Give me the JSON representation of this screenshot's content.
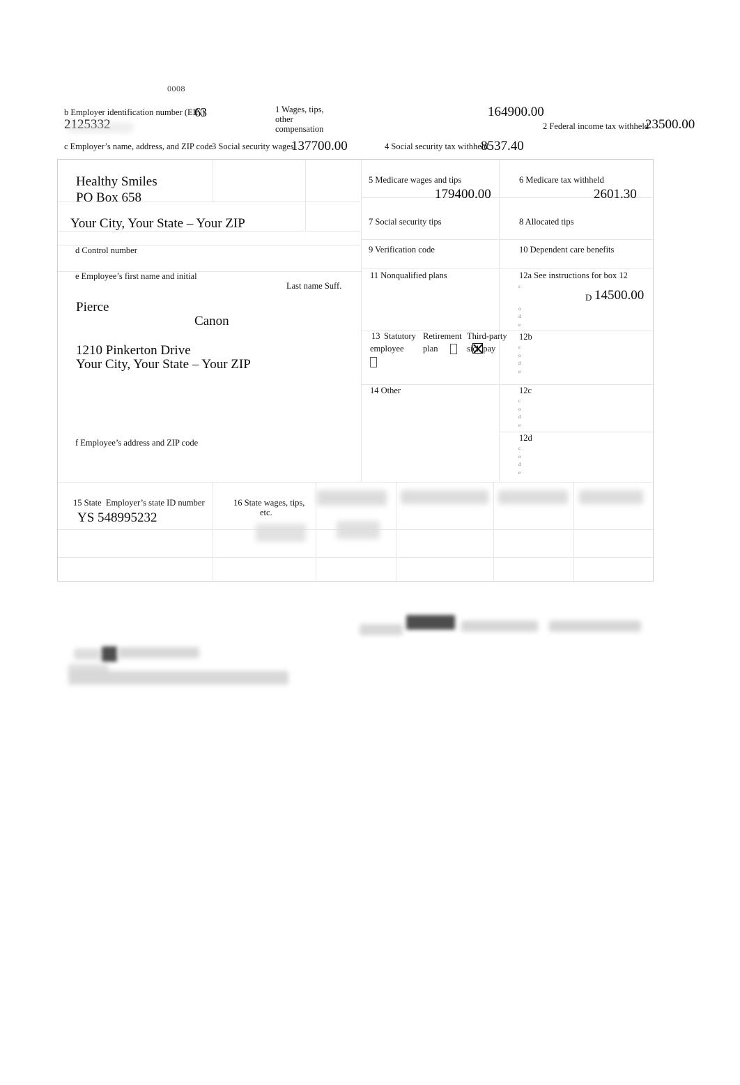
{
  "form": {
    "control_code": "0008",
    "copy_note": ""
  },
  "boxes": {
    "b": {
      "label": "b Employer identification number (EIN)",
      "overlap_text": "63",
      "value": "2125332"
    },
    "c": {
      "label": "c Employer’s name, address, and ZIP code",
      "name": "Healthy Smiles",
      "street": "PO Box 658",
      "citystatezip": "Your City, Your State – Your ZIP"
    },
    "d": {
      "label": "d Control number",
      "value": ""
    },
    "e": {
      "label": "e Employee’s first name and initial",
      "last_name_label": "Last name Suff.",
      "first_name": "Pierce",
      "last_name": "Canon"
    },
    "f": {
      "label": "f Employee’s address and ZIP code",
      "street": "1210 Pinkerton Drive",
      "citystatezip": "Your City, Your State – Your ZIP"
    },
    "b1": {
      "label": "1 Wages, tips, other compensation",
      "label_l1": "1 Wages, tips,",
      "label_l2": "other",
      "label_l3": "compensation",
      "value": "164900.00"
    },
    "b2": {
      "label": "2 Federal income tax withheld",
      "value": "23500.00"
    },
    "b3": {
      "label": "3 Social security wages",
      "value": "137700.00"
    },
    "b4": {
      "label": "4 Social security tax withheld",
      "value": "8537.40"
    },
    "b5": {
      "label": "5 Medicare wages and tips",
      "value": "179400.00"
    },
    "b6": {
      "label": "6 Medicare tax withheld",
      "value": "2601.30"
    },
    "b7": {
      "label": "7 Social security tips",
      "value": ""
    },
    "b8": {
      "label": "8 Allocated tips",
      "value": ""
    },
    "b9": {
      "label": "9 Verification code",
      "value": ""
    },
    "b10": {
      "label": "10 Dependent care benefits",
      "value": ""
    },
    "b11": {
      "label": "11 Nonqualified plans",
      "value": ""
    },
    "b12a": {
      "label": "12a See instructions for box 12",
      "code_stack": [
        "c",
        "o",
        "d",
        "e"
      ],
      "code": "D",
      "value": "14500.00"
    },
    "b12b": {
      "label": "12b",
      "code_stack": [
        "c",
        "o",
        "d",
        "e"
      ],
      "code": "",
      "value": ""
    },
    "b12c": {
      "label": "12c",
      "code_stack": [
        "c",
        "o",
        "d",
        "e"
      ],
      "code": "",
      "value": ""
    },
    "b12d": {
      "label": "12d",
      "code_stack": [
        "c",
        "o",
        "d",
        "e"
      ],
      "code": "",
      "value": ""
    },
    "b13": {
      "number": "13",
      "col1_l1": "Statutory",
      "col1_l2": "employee",
      "col2_l1": "Retirement",
      "col2_l2": "plan",
      "col3_l1": "Third-party",
      "col3_l2": "sick pay",
      "statutory_checked": false,
      "retirement_checked": true,
      "thirdparty_checked": false
    },
    "b14": {
      "label": "14 Other",
      "value": ""
    },
    "b15": {
      "label_l1": "15 State",
      "label_l2": "Employer’s state ID number",
      "label": "15 State  Employer’s state ID number",
      "state": "YS",
      "id_number": "548995232",
      "value": "YS 548995232",
      "row2_state": "",
      "row2_id": ""
    },
    "b16": {
      "label_l1": "16 State wages, tips,",
      "label_l2": "etc.",
      "label": "16 State wages, tips, etc.",
      "value": "",
      "row2_value": ""
    },
    "b17": {
      "label": "",
      "value": "",
      "row2_value": ""
    },
    "b18": {
      "label": "",
      "value": "",
      "row2_value": ""
    },
    "b19": {
      "label": "",
      "value": "",
      "row2_value": ""
    },
    "b20": {
      "label": "",
      "value": "",
      "row2_value": ""
    }
  }
}
